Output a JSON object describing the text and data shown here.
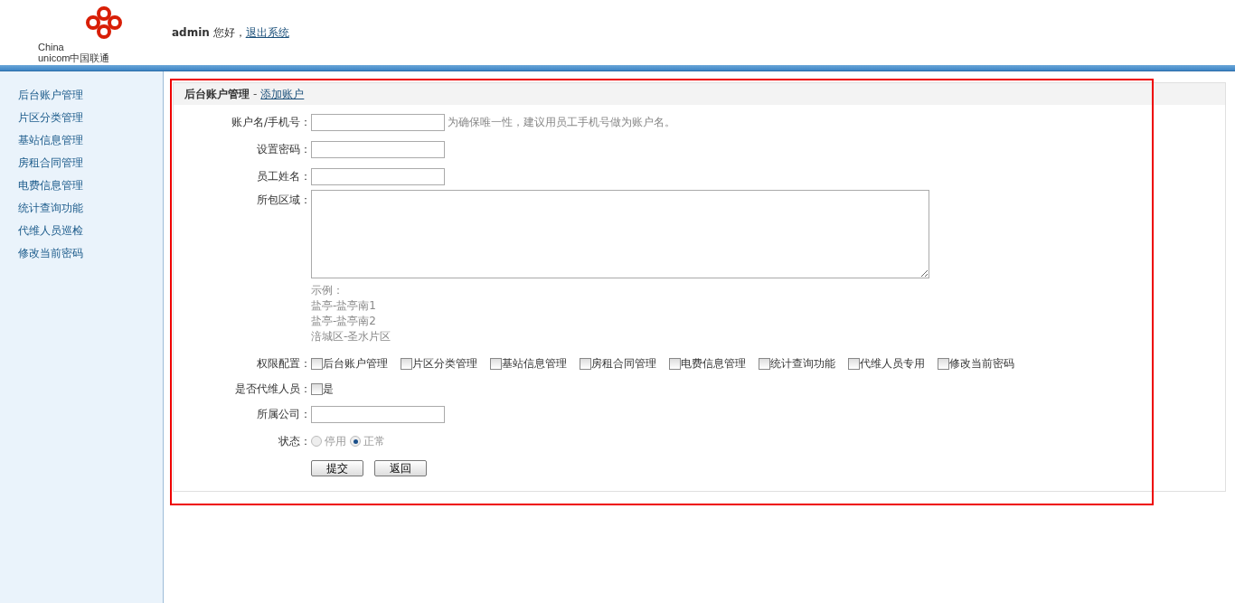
{
  "header": {
    "logo_lines": [
      "China",
      "unicom中国联通"
    ],
    "user": "admin",
    "greeting": "您好，",
    "logout": "退出系统"
  },
  "sidebar": {
    "items": [
      {
        "label": "后台账户管理"
      },
      {
        "label": "片区分类管理"
      },
      {
        "label": "基站信息管理"
      },
      {
        "label": "房租合同管理"
      },
      {
        "label": "电费信息管理"
      },
      {
        "label": "统计查询功能"
      },
      {
        "label": "代维人员巡检"
      },
      {
        "label": "修改当前密码"
      }
    ]
  },
  "panel": {
    "title": "后台账户管理",
    "separator": "-",
    "link": "添加账户"
  },
  "form": {
    "account": {
      "label": "账户名/手机号：",
      "hint": "为确保唯一性，建议用员工手机号做为账户名。"
    },
    "password": {
      "label": "设置密码："
    },
    "name": {
      "label": "员工姓名："
    },
    "region": {
      "label": "所包区域：",
      "example": [
        "示例：",
        "盐亭-盐亭南1",
        "盐亭-盐亭南2",
        "涪城区-圣水片区"
      ]
    },
    "permissions": {
      "label": "权限配置：",
      "options": [
        {
          "label": "后台账户管理",
          "checked": false
        },
        {
          "label": "片区分类管理",
          "checked": false
        },
        {
          "label": "基站信息管理",
          "checked": false
        },
        {
          "label": "房租合同管理",
          "checked": false
        },
        {
          "label": "电费信息管理",
          "checked": false
        },
        {
          "label": "统计查询功能",
          "checked": false
        },
        {
          "label": "代维人员专用",
          "checked": false
        },
        {
          "label": "修改当前密码",
          "checked": false
        }
      ]
    },
    "maintainer": {
      "label": "是否代维人员：",
      "option": "是",
      "checked": false
    },
    "company": {
      "label": "所属公司："
    },
    "status": {
      "label": "状态：",
      "disabled": true,
      "options": [
        {
          "label": "停用",
          "selected": false
        },
        {
          "label": "正常",
          "selected": true
        }
      ]
    },
    "buttons": [
      "提交",
      "返回"
    ]
  }
}
